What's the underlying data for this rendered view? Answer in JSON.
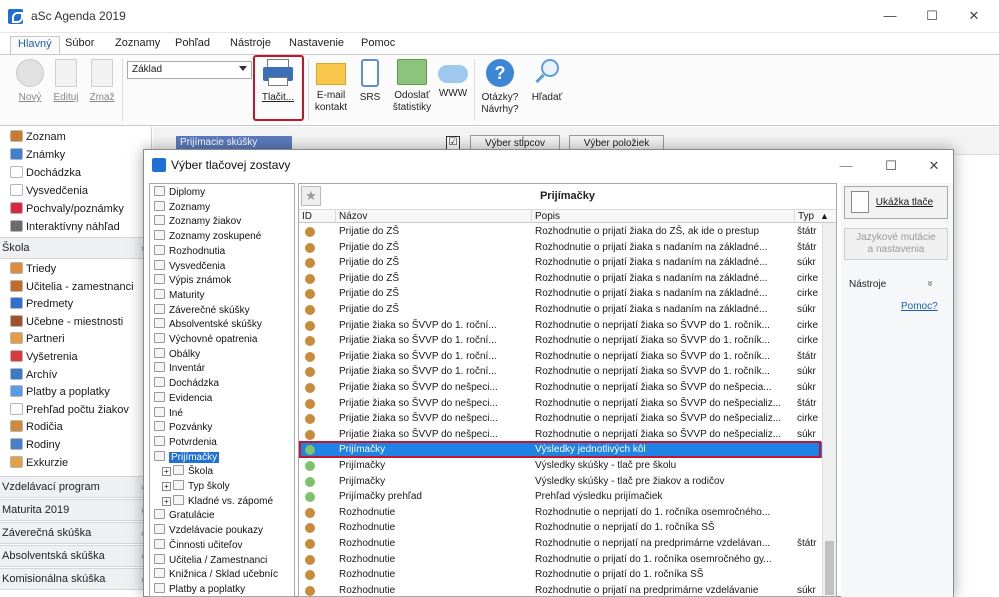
{
  "window": {
    "title": "aSc Agenda 2019",
    "controls": {
      "minimize": "—",
      "maximize": "☐",
      "close": "✕"
    }
  },
  "ribbon": {
    "tabs": [
      "Hlavný",
      "Súbor",
      "Zoznamy",
      "Pohľad",
      "Nástroje",
      "Nastavenie",
      "Pomoc"
    ],
    "buttons": {
      "new": "Nový",
      "edit": "Edituj",
      "delete": "Zmaž",
      "print": "Tlačit...",
      "email_line1": "E-mail",
      "email_line2": "kontakt",
      "sms": "SRS",
      "send_line1": "Odoslať",
      "send_line2": "štatistiky",
      "www": "WWW",
      "faq_line1": "Otázky?",
      "faq_line2": "Návrhy?",
      "search": "Hľadať"
    },
    "report_select": "Základ"
  },
  "sidebar": {
    "top_items": [
      {
        "label": "Zoznam",
        "color": "#c97b2e"
      },
      {
        "label": "Známky",
        "color": "#3e7fd1"
      },
      {
        "label": "Dochádzka",
        "color": "#ffffff"
      },
      {
        "label": "Vysvedčenia",
        "color": "#ffffff"
      },
      {
        "label": "Pochvaly/poznámky",
        "color": "#d7263d"
      },
      {
        "label": "Interaktívny náhľad",
        "color": "#6b6b6b"
      }
    ],
    "sections": {
      "school": "Škola",
      "programs": "Vzdelávací program",
      "maturita": "Maturita 2019",
      "final": "Záverečná skúška",
      "absolvent": "Absolventská skúška",
      "komisional": "Komisionálna skúška"
    },
    "school_items": [
      {
        "label": "Triedy",
        "color": "#e08a3c"
      },
      {
        "label": "Učitelia - zamestnanci",
        "color": "#c26b2a"
      },
      {
        "label": "Predmety",
        "color": "#2f6fd0"
      },
      {
        "label": "Učebne - miestnosti",
        "color": "#a0522d"
      },
      {
        "label": "Partneri",
        "color": "#e39b47"
      },
      {
        "label": "Vyšetrenia",
        "color": "#d83a3a"
      },
      {
        "label": "Archív",
        "color": "#3b79c9"
      },
      {
        "label": "Platby a poplatky",
        "color": "#5a9be6"
      },
      {
        "label": "Prehľad počtu žiakov",
        "color": "#ffffff"
      },
      {
        "label": "Rodičia",
        "color": "#d08a3a"
      },
      {
        "label": "Rodiny",
        "color": "#4a7fc9"
      },
      {
        "label": "Exkurzie",
        "color": "#e3a046"
      }
    ]
  },
  "main_area": {
    "combo": "Prijímacie skúšky",
    "check": "☑",
    "btn_columns": "Výber stĺpcov",
    "btn_items": "Výber položiek"
  },
  "dialog": {
    "title": "Výber tlačovej zostavy",
    "controls": {
      "minimize": "—",
      "maximize": "☐",
      "close": "✕"
    },
    "tree": [
      {
        "label": "Diplomy",
        "indent": 0
      },
      {
        "label": "Zoznamy",
        "indent": 0
      },
      {
        "label": "Zoznamy žiakov",
        "indent": 0
      },
      {
        "label": "Zoznamy zoskupené",
        "indent": 0
      },
      {
        "label": "Rozhodnutia",
        "indent": 0
      },
      {
        "label": "Vysvedčenia",
        "indent": 0
      },
      {
        "label": "Výpis známok",
        "indent": 0
      },
      {
        "label": "Maturity",
        "indent": 0
      },
      {
        "label": "Záverečné skúšky",
        "indent": 0
      },
      {
        "label": "Absolventské skúšky",
        "indent": 0
      },
      {
        "label": "Výchovné opatrenia",
        "indent": 0
      },
      {
        "label": "Obálky",
        "indent": 0
      },
      {
        "label": "Inventár",
        "indent": 0
      },
      {
        "label": "Dochádzka",
        "indent": 0
      },
      {
        "label": "Evidencia",
        "indent": 0
      },
      {
        "label": "Iné",
        "indent": 0
      },
      {
        "label": "Pozvánky",
        "indent": 0
      },
      {
        "label": "Potvrdenia",
        "indent": 0
      },
      {
        "label": "Prijímačky",
        "indent": 0,
        "selected": true
      },
      {
        "label": "Škola",
        "indent": 1,
        "expander": "+"
      },
      {
        "label": "Typ školy",
        "indent": 1,
        "expander": "+"
      },
      {
        "label": "Kladné vs. zápomé",
        "indent": 1,
        "expander": "+"
      },
      {
        "label": "Gratulácie",
        "indent": 0
      },
      {
        "label": "Vzdelávacie poukazy",
        "indent": 0
      },
      {
        "label": "Činnosti učiteľov",
        "indent": 0
      },
      {
        "label": "Učitelia / Zamestnanci",
        "indent": 0
      },
      {
        "label": "Knižnica / Sklad učebníc",
        "indent": 0
      },
      {
        "label": "Platby a poplatky",
        "indent": 0
      }
    ],
    "grid": {
      "title": "Prijímačky",
      "star": "★",
      "columns": {
        "id": "ID",
        "name": "Názov",
        "desc": "Popis",
        "type": "Typ"
      },
      "sort_arrow": "▲",
      "rows": [
        {
          "name": "Prijatie do ZŠ",
          "desc": "Rozhodnutie o prijatí žiaka do ZŠ, ak ide o prestup",
          "type": "štátr",
          "color": "#c98a3a"
        },
        {
          "name": "Prijatie do ZŠ",
          "desc": "Rozhodnutie o prijatí žiaka s nadaním na základné...",
          "type": "štátr",
          "color": "#c98a3a"
        },
        {
          "name": "Prijatie do ZŠ",
          "desc": "Rozhodnutie o prijatí žiaka s nadaním na základné...",
          "type": "súkr",
          "color": "#c98a3a"
        },
        {
          "name": "Prijatie do ZŠ",
          "desc": "Rozhodnutie o prijatí žiaka s nadaním na základné...",
          "type": "cirke",
          "color": "#c98a3a"
        },
        {
          "name": "Prijatie do ZŠ",
          "desc": "Rozhodnutie o prijatí žiaka s nadaním na základné...",
          "type": "cirke",
          "color": "#c98a3a"
        },
        {
          "name": "Prijatie do ZŠ",
          "desc": "Rozhodnutie o prijatí žiaka s nadaním na základné...",
          "type": "súkr",
          "color": "#c98a3a"
        },
        {
          "name": "Prijatie žiaka so ŠVVP do 1. roční...",
          "desc": "Rozhodnutie o neprijatí žiaka so ŠVVP do 1. ročník...",
          "type": "cirke",
          "color": "#c98a3a"
        },
        {
          "name": "Prijatie žiaka so ŠVVP do 1. roční...",
          "desc": "Rozhodnutie o neprijatí žiaka so ŠVVP do 1. ročník...",
          "type": "cirke",
          "color": "#c98a3a"
        },
        {
          "name": "Prijatie žiaka so ŠVVP do 1. roční...",
          "desc": "Rozhodnutie o neprijatí žiaka so ŠVVP do 1. ročník...",
          "type": "štátr",
          "color": "#c98a3a"
        },
        {
          "name": "Prijatie žiaka so ŠVVP do 1. roční...",
          "desc": "Rozhodnutie o neprijatí žiaka so ŠVVP do 1. ročník...",
          "type": "súkr",
          "color": "#c98a3a"
        },
        {
          "name": "Prijatie žiaka so ŠVVP do nešpeci...",
          "desc": "Rozhodnutie o neprijatí žiaka so ŠVVP do nešpecia...",
          "type": "súkr",
          "color": "#c98a3a"
        },
        {
          "name": "Prijatie žiaka so ŠVVP do nešpeci...",
          "desc": "Rozhodnutie o neprijatí žiaka so ŠVVP do nešpecializ...",
          "type": "štátr",
          "color": "#c98a3a"
        },
        {
          "name": "Prijatie žiaka so ŠVVP do nešpeci...",
          "desc": "Rozhodnutie o neprijatí žiaka so ŠVVP do nešpecializ...",
          "type": "cirke",
          "color": "#c98a3a"
        },
        {
          "name": "Prijatie žiaka so ŠVVP do nešpeci...",
          "desc": "Rozhodnutie o neprijatí žiaka so ŠVVP do nešpecializ...",
          "type": "súkr",
          "color": "#c98a3a"
        },
        {
          "name": "Prijímačky",
          "desc": "Výsledky jednotlivých kôl",
          "type": "",
          "color": "#7cc36b",
          "selected": true
        },
        {
          "name": "Prijímačky",
          "desc": "Výsledky skúšky - tlač pre školu",
          "type": "",
          "color": "#7cc36b"
        },
        {
          "name": "Prijímačky",
          "desc": "Výsledky skúšky - tlač pre žiakov a rodičov",
          "type": "",
          "color": "#7cc36b"
        },
        {
          "name": "Prijímačky prehľad",
          "desc": "Prehľad výsledku prijímačiek",
          "type": "",
          "color": "#7cc36b"
        },
        {
          "name": "Rozhodnutie",
          "desc": "Rozhodnutie o neprijatí do 1. ročníka osemročného...",
          "type": "",
          "color": "#c98a3a"
        },
        {
          "name": "Rozhodnutie",
          "desc": "Rozhodnutie o neprijatí do 1. ročníka SŠ",
          "type": "",
          "color": "#c98a3a"
        },
        {
          "name": "Rozhodnutie",
          "desc": "Rozhodnutie o neprijatí na predprimárne vzdelávan...",
          "type": "štátr",
          "color": "#c98a3a"
        },
        {
          "name": "Rozhodnutie",
          "desc": "Rozhodnutie o prijatí do 1. ročníka osemročného gy...",
          "type": "",
          "color": "#c98a3a"
        },
        {
          "name": "Rozhodnutie",
          "desc": "Rozhodnutie o prijatí do 1. ročníka SŠ",
          "type": "",
          "color": "#c98a3a"
        },
        {
          "name": "Rozhodnutie",
          "desc": "Rozhodnutie o prijatí na predprimárne vzdelávanie",
          "type": "súkr",
          "color": "#c98a3a"
        }
      ]
    },
    "right_panel": {
      "preview": "Ukážka tlače",
      "lang_line1": "Jazykové mutácie",
      "lang_line2": "a nastavenia",
      "tools": "Nástroje",
      "tools_chev": "»",
      "help": "Pomoc?"
    }
  },
  "colors": {
    "accent": "#1f6fd6",
    "highlight": "#c0182a",
    "selection": "#1f82e6"
  }
}
